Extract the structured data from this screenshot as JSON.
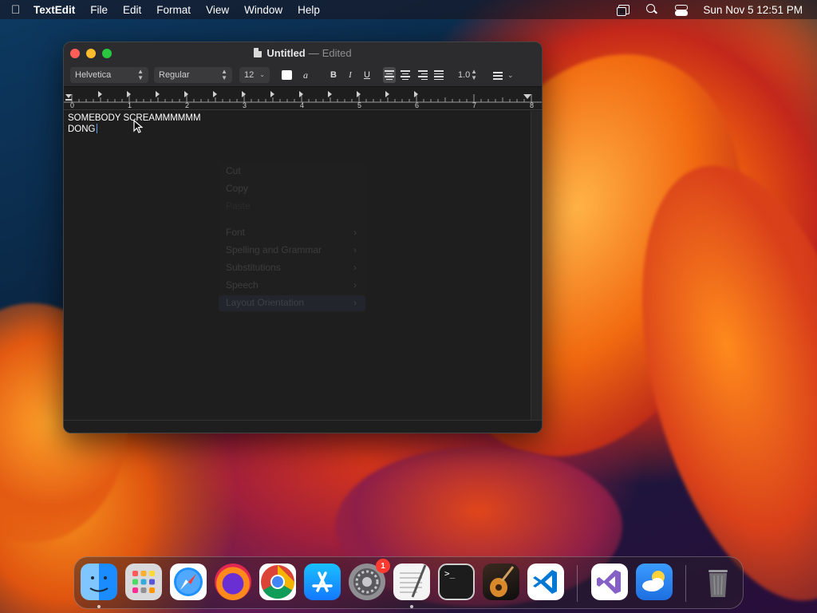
{
  "menubar": {
    "app_name": "TextEdit",
    "items": [
      "File",
      "Edit",
      "Format",
      "View",
      "Window",
      "Help"
    ],
    "clock": "Sun Nov 5  12:51 PM"
  },
  "window": {
    "title": "Untitled",
    "separator": "—",
    "status": "Edited",
    "toolbar": {
      "font_family": "Helvetica",
      "font_style": "Regular",
      "font_size": "12",
      "text_color": "#ffffff",
      "highlight_label": "a",
      "bold_label": "B",
      "italic_label": "I",
      "underline_label": "U",
      "line_spacing": "1.0",
      "active_alignment": "left"
    },
    "ruler": {
      "numbers": [
        "0",
        "1",
        "2",
        "3",
        "4",
        "5",
        "6",
        "7",
        "8"
      ]
    },
    "document": {
      "lines": [
        "SOMEBODY SCREAMMMMMM",
        "DONG"
      ]
    }
  },
  "context_menu_ghost": {
    "items": [
      {
        "label": "Cut",
        "submenu": false
      },
      {
        "label": "Copy",
        "submenu": false
      },
      {
        "label": "Paste",
        "submenu": false
      },
      {
        "label": "Font",
        "submenu": true
      },
      {
        "label": "Spelling and Grammar",
        "submenu": true
      },
      {
        "label": "Substitutions",
        "submenu": true
      },
      {
        "label": "Speech",
        "submenu": true
      },
      {
        "label": "Layout Orientation",
        "submenu": true
      }
    ]
  },
  "dock": {
    "apps": [
      {
        "name": "finder-icon",
        "running": true
      },
      {
        "name": "launchpad-icon",
        "running": false
      },
      {
        "name": "safari-icon",
        "running": false
      },
      {
        "name": "firefox-icon",
        "running": false
      },
      {
        "name": "chrome-icon",
        "running": false
      },
      {
        "name": "app-store-icon",
        "running": false
      },
      {
        "name": "system-settings-icon",
        "running": false,
        "badge": "1"
      },
      {
        "name": "textedit-icon",
        "running": true
      },
      {
        "name": "terminal-icon",
        "running": false
      },
      {
        "name": "garageband-icon",
        "running": false
      },
      {
        "name": "vscode-icon",
        "running": false
      },
      {
        "name": "visual-studio-icon",
        "running": false
      },
      {
        "name": "weather-icon",
        "running": false
      },
      {
        "name": "trash-icon",
        "running": false
      }
    ],
    "terminal_glyph": ">_"
  },
  "colors": {
    "close": "#ff5f57",
    "minimize": "#febc2e",
    "maximize": "#28c840",
    "badge": "#ff3b30"
  }
}
